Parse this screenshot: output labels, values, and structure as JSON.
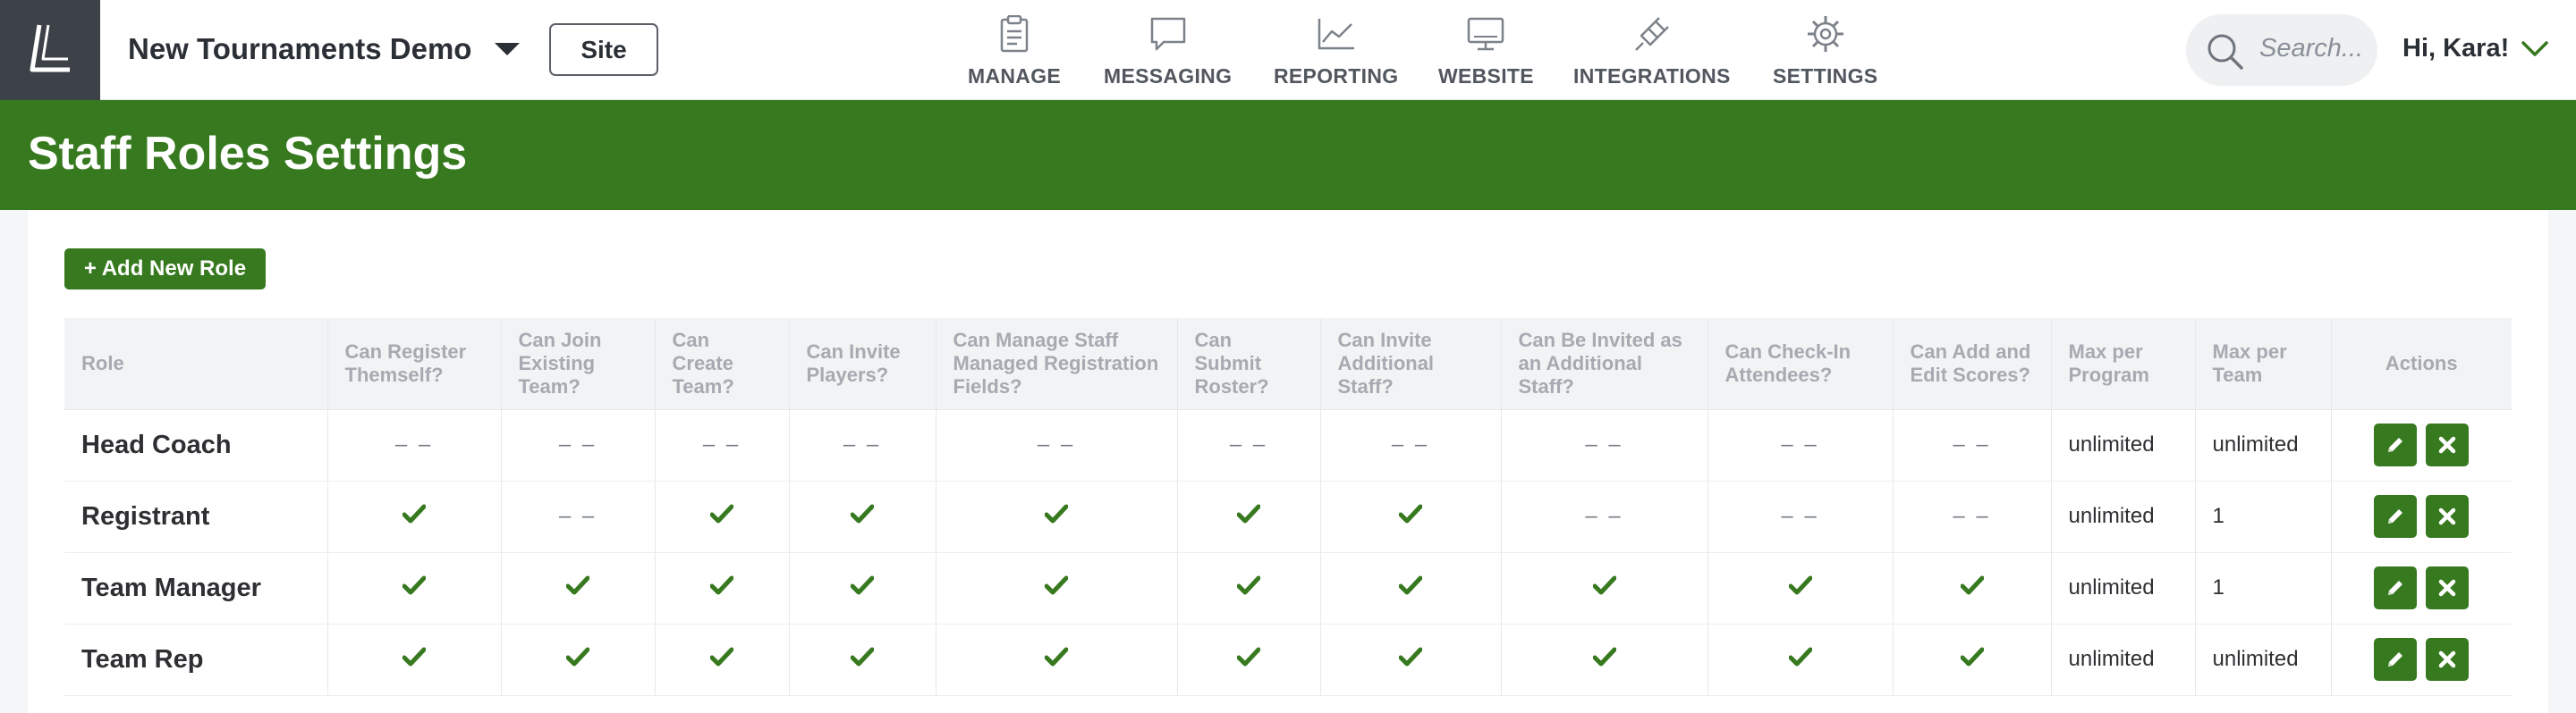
{
  "header": {
    "org_name": "New Tournaments Demo",
    "site_label": "Site",
    "search_placeholder": "Search...",
    "greeting": "Hi, Kara!"
  },
  "nav": [
    {
      "label": "MANAGE",
      "icon": "clipboard-icon"
    },
    {
      "label": "MESSAGING",
      "icon": "chat-bubble-icon"
    },
    {
      "label": "REPORTING",
      "icon": "line-chart-icon"
    },
    {
      "label": "WEBSITE",
      "icon": "monitor-icon"
    },
    {
      "label": "INTEGRATIONS",
      "icon": "plug-icon"
    },
    {
      "label": "SETTINGS",
      "icon": "gear-icon"
    }
  ],
  "page_title": "Staff Roles Settings",
  "add_role_label": "+ Add New Role",
  "colors": {
    "brand_green": "#37791f",
    "logo_bg": "#3d4249"
  },
  "table": {
    "headers": [
      "Role",
      "Can Register Themself?",
      "Can Join Existing Team?",
      "Can Create Team?",
      "Can Invite Players?",
      "Can Manage Staff Managed Registration Fields?",
      "Can Submit Roster?",
      "Can Invite Additional Staff?",
      "Can Be Invited as an Additional Staff?",
      "Can Check-In Attendees?",
      "Can Add and Edit Scores?",
      "Max per Program",
      "Max per Team",
      "Actions"
    ],
    "dash_text": "– –",
    "rows": [
      {
        "role": "Head Coach",
        "perms": [
          false,
          false,
          false,
          false,
          false,
          false,
          false,
          false,
          false,
          false
        ],
        "max_program": "unlimited",
        "max_team": "unlimited"
      },
      {
        "role": "Registrant",
        "perms": [
          true,
          false,
          true,
          true,
          true,
          true,
          true,
          false,
          false,
          false
        ],
        "max_program": "unlimited",
        "max_team": "1"
      },
      {
        "role": "Team Manager",
        "perms": [
          true,
          true,
          true,
          true,
          true,
          true,
          true,
          true,
          true,
          true
        ],
        "max_program": "unlimited",
        "max_team": "1"
      },
      {
        "role": "Team Rep",
        "perms": [
          true,
          true,
          true,
          true,
          true,
          true,
          true,
          true,
          true,
          true
        ],
        "max_program": "unlimited",
        "max_team": "unlimited"
      }
    ]
  }
}
